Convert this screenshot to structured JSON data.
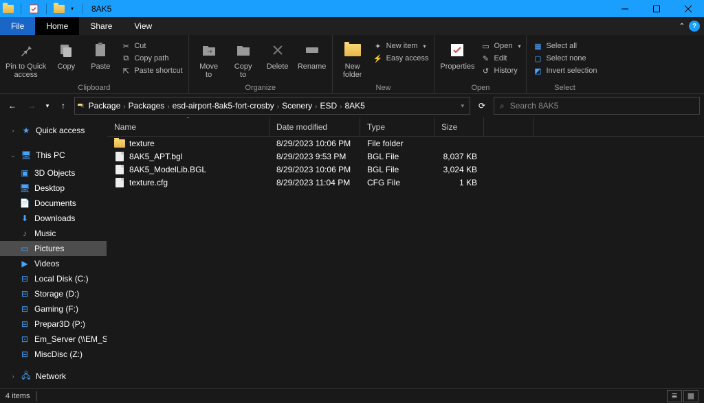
{
  "window": {
    "title": "8AK5"
  },
  "menu": {
    "file": "File",
    "tabs": [
      "Home",
      "Share",
      "View"
    ],
    "active": 0
  },
  "ribbon": {
    "clipboard": {
      "label": "Clipboard",
      "pin": "Pin to Quick\naccess",
      "copy": "Copy",
      "paste": "Paste",
      "cut": "Cut",
      "copypath": "Copy path",
      "shortcut": "Paste shortcut"
    },
    "organize": {
      "label": "Organize",
      "moveto": "Move\nto",
      "copyto": "Copy\nto",
      "delete": "Delete",
      "rename": "Rename"
    },
    "new": {
      "label": "New",
      "newfolder": "New\nfolder",
      "newitem": "New item",
      "easy": "Easy access"
    },
    "open": {
      "label": "Open",
      "properties": "Properties",
      "open": "Open",
      "edit": "Edit",
      "history": "History"
    },
    "select": {
      "label": "Select",
      "all": "Select all",
      "none": "Select none",
      "invert": "Invert selection"
    }
  },
  "breadcrumbs": [
    "Package",
    "Packages",
    "esd-airport-8ak5-fort-crosby",
    "Scenery",
    "ESD",
    "8AK5"
  ],
  "search": {
    "placeholder": "Search 8AK5"
  },
  "sidebar": {
    "quick": "Quick access",
    "pc": "This PC",
    "pc_items": [
      "3D Objects",
      "Desktop",
      "Documents",
      "Downloads",
      "Music",
      "Pictures",
      "Videos",
      "Local Disk (C:)",
      "Storage (D:)",
      "Gaming (F:)",
      "Prepar3D (P:)",
      "Em_Server (\\\\EM_SE",
      "MiscDisc (Z:)"
    ],
    "pc_sel_index": 5,
    "network": "Network"
  },
  "columns": {
    "name": "Name",
    "date": "Date modified",
    "type": "Type",
    "size": "Size",
    "sort": "name",
    "dir": "asc"
  },
  "files": [
    {
      "icon": "folder",
      "name": "texture",
      "date": "8/29/2023 10:06 PM",
      "type": "File folder",
      "size": ""
    },
    {
      "icon": "file",
      "name": "8AK5_APT.bgl",
      "date": "8/29/2023 9:53 PM",
      "type": "BGL File",
      "size": "8,037 KB"
    },
    {
      "icon": "file",
      "name": "8AK5_ModelLib.BGL",
      "date": "8/29/2023 10:06 PM",
      "type": "BGL File",
      "size": "3,024 KB"
    },
    {
      "icon": "file",
      "name": "texture.cfg",
      "date": "8/29/2023 11:04 PM",
      "type": "CFG File",
      "size": "1 KB"
    }
  ],
  "status": {
    "count": "4 items"
  }
}
